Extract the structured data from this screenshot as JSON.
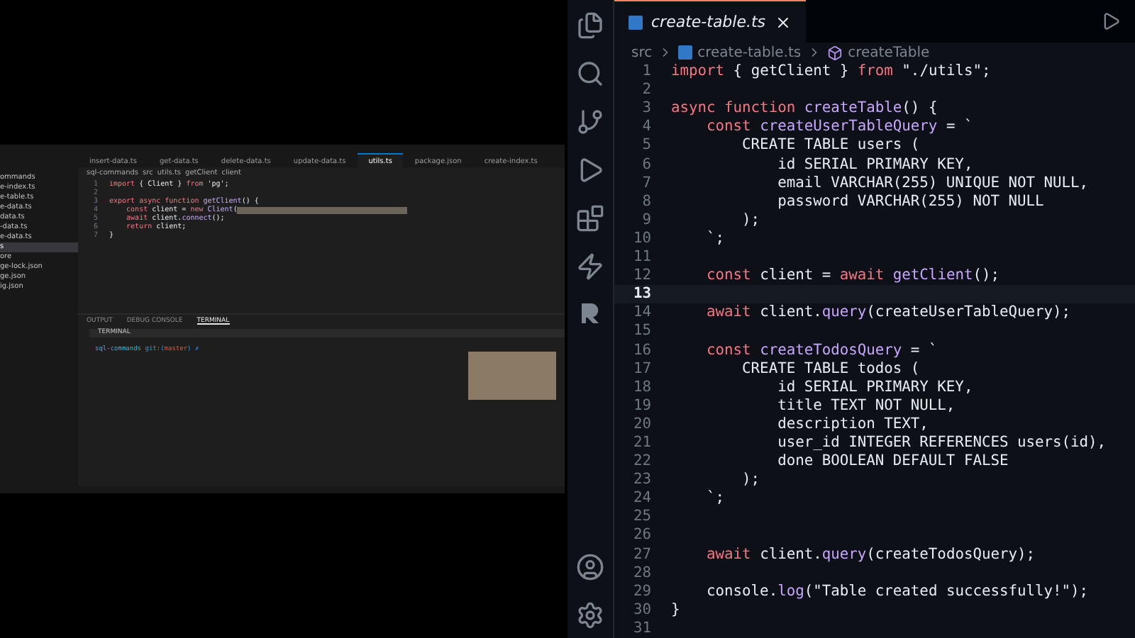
{
  "recording_window": {
    "tabs": [
      {
        "label": "insert-data.ts",
        "selected": false
      },
      {
        "label": "get-data.ts",
        "selected": false
      },
      {
        "label": "delete-data.ts",
        "selected": false
      },
      {
        "label": "update-data.ts",
        "selected": false
      },
      {
        "label": "utils.ts",
        "selected": true
      },
      {
        "label": "package.json",
        "selected": false
      },
      {
        "label": "create-index.ts",
        "selected": false
      }
    ],
    "breadcrumb": [
      "sql-commands",
      "src",
      "utils.ts",
      "getClient",
      "client"
    ],
    "explorer": [
      {
        "label": "ommands",
        "selected": false
      },
      {
        "label": "e-index.ts",
        "selected": false
      },
      {
        "label": "e-table.ts",
        "selected": false
      },
      {
        "label": "e-data.ts",
        "selected": false
      },
      {
        "label": "data.ts",
        "selected": false
      },
      {
        "label": "-data.ts",
        "selected": false
      },
      {
        "label": "e-data.ts",
        "selected": false
      },
      {
        "label": "s",
        "selected": true
      },
      {
        "label": "ore",
        "selected": false
      },
      {
        "label": "ge-lock.json",
        "selected": false
      },
      {
        "label": "ge.json",
        "selected": false
      },
      {
        "label": "ig.json",
        "selected": false
      }
    ],
    "code": [
      {
        "number": "1",
        "tokens": [
          {
            "text": "import",
            "kind": "keyword"
          },
          {
            "text": " { Client } ",
            "kind": "plain"
          },
          {
            "text": "from",
            "kind": "keyword"
          },
          {
            "text": " 'pg';",
            "kind": "string"
          }
        ]
      },
      {
        "number": "2"
      },
      {
        "number": "3",
        "tokens": [
          {
            "text": "export async function",
            "kind": "keyword"
          },
          {
            "text": " getClient",
            "kind": "function"
          },
          {
            "text": "() {",
            "kind": "plain"
          }
        ]
      },
      {
        "number": "4",
        "redacted": true,
        "tokens": [
          {
            "text": "    const",
            "kind": "keyword"
          },
          {
            "text": " client = ",
            "kind": "plain"
          },
          {
            "text": "new",
            "kind": "keyword"
          },
          {
            "text": " Client",
            "kind": "function"
          },
          {
            "text": "(",
            "kind": "plain"
          }
        ]
      },
      {
        "number": "5",
        "tokens": [
          {
            "text": "    await",
            "kind": "keyword"
          },
          {
            "text": " client.",
            "kind": "plain"
          },
          {
            "text": "connect",
            "kind": "function"
          },
          {
            "text": "();",
            "kind": "plain"
          }
        ]
      },
      {
        "number": "6",
        "tokens": [
          {
            "text": "    return",
            "kind": "keyword"
          },
          {
            "text": " client;",
            "kind": "plain"
          }
        ]
      },
      {
        "number": "7",
        "tokens": [
          {
            "text": "}",
            "kind": "plain"
          }
        ]
      }
    ],
    "panel_tabs": [
      {
        "label": "OUTPUT",
        "selected": false
      },
      {
        "label": "DEBUG CONSOLE",
        "selected": false
      },
      {
        "label": "TERMINAL",
        "selected": true
      }
    ],
    "terminal_title": "TERMINAL",
    "prompt": {
      "dir": "sql-commands",
      "git": "git:(",
      "branch": "master",
      "end": ") ✗"
    }
  },
  "editor": {
    "tab": {
      "label": "create-table.ts",
      "selected": true
    },
    "breadcrumb": [
      "src",
      "create-table.ts",
      "createTable"
    ],
    "lines": [
      {
        "number": "1",
        "current": false,
        "tokens": [
          {
            "text": "import",
            "kind": "keyword"
          },
          {
            "text": " { getClient } ",
            "kind": "plain"
          },
          {
            "text": "from",
            "kind": "keyword"
          },
          {
            "text": " \"./utils\";",
            "kind": "string"
          }
        ]
      },
      {
        "number": "2",
        "current": false
      },
      {
        "number": "3",
        "current": false,
        "tokens": [
          {
            "text": "async function",
            "kind": "keyword"
          },
          {
            "text": " createTable",
            "kind": "function"
          },
          {
            "text": "() {",
            "kind": "plain"
          }
        ]
      },
      {
        "number": "4",
        "current": false,
        "tokens": [
          {
            "text": "    const",
            "kind": "keyword"
          },
          {
            "text": " createUserTableQuery",
            "kind": "function"
          },
          {
            "text": " = `",
            "kind": "plain"
          }
        ]
      },
      {
        "number": "5",
        "current": false,
        "tokens": [
          {
            "text": "        CREATE TABLE users (",
            "kind": "string"
          }
        ]
      },
      {
        "number": "6",
        "current": false,
        "tokens": [
          {
            "text": "            id SERIAL PRIMARY KEY,",
            "kind": "string"
          }
        ]
      },
      {
        "number": "7",
        "current": false,
        "tokens": [
          {
            "text": "            email VARCHAR(255) UNIQUE NOT NULL,",
            "kind": "string"
          }
        ]
      },
      {
        "number": "8",
        "current": false,
        "tokens": [
          {
            "text": "            password VARCHAR(255) NOT NULL",
            "kind": "string"
          }
        ]
      },
      {
        "number": "9",
        "current": false,
        "tokens": [
          {
            "text": "        );",
            "kind": "string"
          }
        ]
      },
      {
        "number": "10",
        "current": false,
        "tokens": [
          {
            "text": "    `;",
            "kind": "plain"
          }
        ]
      },
      {
        "number": "11",
        "current": false
      },
      {
        "number": "12",
        "current": false,
        "tokens": [
          {
            "text": "    const",
            "kind": "keyword"
          },
          {
            "text": " client = ",
            "kind": "plain"
          },
          {
            "text": "await",
            "kind": "keyword"
          },
          {
            "text": " getClient",
            "kind": "function"
          },
          {
            "text": "();",
            "kind": "plain"
          }
        ]
      },
      {
        "number": "13",
        "current": true
      },
      {
        "number": "14",
        "current": false,
        "tokens": [
          {
            "text": "    await",
            "kind": "keyword"
          },
          {
            "text": " client.",
            "kind": "plain"
          },
          {
            "text": "query",
            "kind": "function"
          },
          {
            "text": "(createUserTableQuery);",
            "kind": "plain"
          }
        ]
      },
      {
        "number": "15",
        "current": false
      },
      {
        "number": "16",
        "current": false,
        "tokens": [
          {
            "text": "    const",
            "kind": "keyword"
          },
          {
            "text": " createTodosQuery",
            "kind": "function"
          },
          {
            "text": " = `",
            "kind": "plain"
          }
        ]
      },
      {
        "number": "17",
        "current": false,
        "tokens": [
          {
            "text": "        CREATE TABLE todos (",
            "kind": "string"
          }
        ]
      },
      {
        "number": "18",
        "current": false,
        "tokens": [
          {
            "text": "            id SERIAL PRIMARY KEY,",
            "kind": "string"
          }
        ]
      },
      {
        "number": "19",
        "current": false,
        "tokens": [
          {
            "text": "            title TEXT NOT NULL,",
            "kind": "string"
          }
        ]
      },
      {
        "number": "20",
        "current": false,
        "tokens": [
          {
            "text": "            description TEXT,",
            "kind": "string"
          }
        ]
      },
      {
        "number": "21",
        "current": false,
        "tokens": [
          {
            "text": "            user_id INTEGER REFERENCES users(id),",
            "kind": "string"
          }
        ]
      },
      {
        "number": "22",
        "current": false,
        "tokens": [
          {
            "text": "            done BOOLEAN DEFAULT FALSE",
            "kind": "string"
          }
        ]
      },
      {
        "number": "23",
        "current": false,
        "tokens": [
          {
            "text": "        );",
            "kind": "string"
          }
        ]
      },
      {
        "number": "24",
        "current": false,
        "tokens": [
          {
            "text": "    `;",
            "kind": "plain"
          }
        ]
      },
      {
        "number": "25",
        "current": false
      },
      {
        "number": "26",
        "current": false
      },
      {
        "number": "27",
        "current": false,
        "tokens": [
          {
            "text": "    await",
            "kind": "keyword"
          },
          {
            "text": " client.",
            "kind": "plain"
          },
          {
            "text": "query",
            "kind": "function"
          },
          {
            "text": "(createTodosQuery);",
            "kind": "plain"
          }
        ]
      },
      {
        "number": "28",
        "current": false
      },
      {
        "number": "29",
        "current": false,
        "tokens": [
          {
            "text": "    console.",
            "kind": "plain"
          },
          {
            "text": "log",
            "kind": "function"
          },
          {
            "text": "(\"Table created successfully!\");",
            "kind": "string"
          }
        ]
      },
      {
        "number": "30",
        "current": false,
        "tokens": [
          {
            "text": "}",
            "kind": "plain"
          }
        ]
      },
      {
        "number": "31",
        "current": false
      }
    ]
  }
}
